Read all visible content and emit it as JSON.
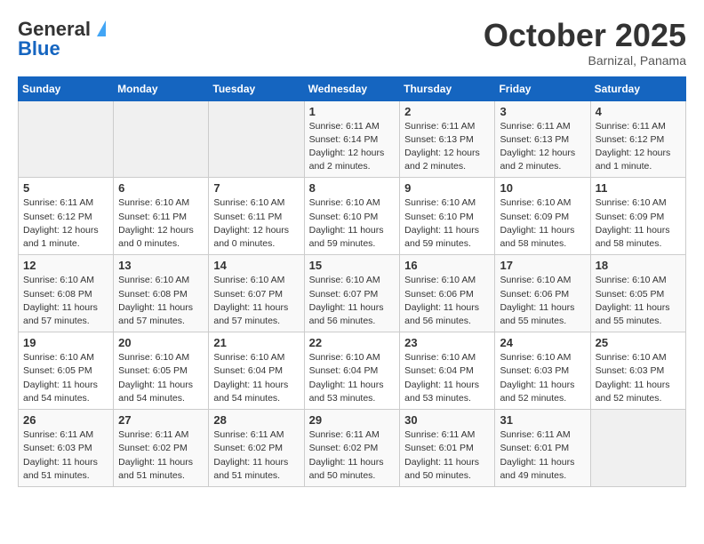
{
  "header": {
    "logo_general": "General",
    "logo_blue": "Blue",
    "month": "October 2025",
    "location": "Barnizal, Panama"
  },
  "days_of_week": [
    "Sunday",
    "Monday",
    "Tuesday",
    "Wednesday",
    "Thursday",
    "Friday",
    "Saturday"
  ],
  "weeks": [
    [
      {
        "day": "",
        "info": ""
      },
      {
        "day": "",
        "info": ""
      },
      {
        "day": "",
        "info": ""
      },
      {
        "day": "1",
        "info": "Sunrise: 6:11 AM\nSunset: 6:14 PM\nDaylight: 12 hours and 2 minutes."
      },
      {
        "day": "2",
        "info": "Sunrise: 6:11 AM\nSunset: 6:13 PM\nDaylight: 12 hours and 2 minutes."
      },
      {
        "day": "3",
        "info": "Sunrise: 6:11 AM\nSunset: 6:13 PM\nDaylight: 12 hours and 2 minutes."
      },
      {
        "day": "4",
        "info": "Sunrise: 6:11 AM\nSunset: 6:12 PM\nDaylight: 12 hours and 1 minute."
      }
    ],
    [
      {
        "day": "5",
        "info": "Sunrise: 6:11 AM\nSunset: 6:12 PM\nDaylight: 12 hours and 1 minute."
      },
      {
        "day": "6",
        "info": "Sunrise: 6:10 AM\nSunset: 6:11 PM\nDaylight: 12 hours and 0 minutes."
      },
      {
        "day": "7",
        "info": "Sunrise: 6:10 AM\nSunset: 6:11 PM\nDaylight: 12 hours and 0 minutes."
      },
      {
        "day": "8",
        "info": "Sunrise: 6:10 AM\nSunset: 6:10 PM\nDaylight: 11 hours and 59 minutes."
      },
      {
        "day": "9",
        "info": "Sunrise: 6:10 AM\nSunset: 6:10 PM\nDaylight: 11 hours and 59 minutes."
      },
      {
        "day": "10",
        "info": "Sunrise: 6:10 AM\nSunset: 6:09 PM\nDaylight: 11 hours and 58 minutes."
      },
      {
        "day": "11",
        "info": "Sunrise: 6:10 AM\nSunset: 6:09 PM\nDaylight: 11 hours and 58 minutes."
      }
    ],
    [
      {
        "day": "12",
        "info": "Sunrise: 6:10 AM\nSunset: 6:08 PM\nDaylight: 11 hours and 57 minutes."
      },
      {
        "day": "13",
        "info": "Sunrise: 6:10 AM\nSunset: 6:08 PM\nDaylight: 11 hours and 57 minutes."
      },
      {
        "day": "14",
        "info": "Sunrise: 6:10 AM\nSunset: 6:07 PM\nDaylight: 11 hours and 57 minutes."
      },
      {
        "day": "15",
        "info": "Sunrise: 6:10 AM\nSunset: 6:07 PM\nDaylight: 11 hours and 56 minutes."
      },
      {
        "day": "16",
        "info": "Sunrise: 6:10 AM\nSunset: 6:06 PM\nDaylight: 11 hours and 56 minutes."
      },
      {
        "day": "17",
        "info": "Sunrise: 6:10 AM\nSunset: 6:06 PM\nDaylight: 11 hours and 55 minutes."
      },
      {
        "day": "18",
        "info": "Sunrise: 6:10 AM\nSunset: 6:05 PM\nDaylight: 11 hours and 55 minutes."
      }
    ],
    [
      {
        "day": "19",
        "info": "Sunrise: 6:10 AM\nSunset: 6:05 PM\nDaylight: 11 hours and 54 minutes."
      },
      {
        "day": "20",
        "info": "Sunrise: 6:10 AM\nSunset: 6:05 PM\nDaylight: 11 hours and 54 minutes."
      },
      {
        "day": "21",
        "info": "Sunrise: 6:10 AM\nSunset: 6:04 PM\nDaylight: 11 hours and 54 minutes."
      },
      {
        "day": "22",
        "info": "Sunrise: 6:10 AM\nSunset: 6:04 PM\nDaylight: 11 hours and 53 minutes."
      },
      {
        "day": "23",
        "info": "Sunrise: 6:10 AM\nSunset: 6:04 PM\nDaylight: 11 hours and 53 minutes."
      },
      {
        "day": "24",
        "info": "Sunrise: 6:10 AM\nSunset: 6:03 PM\nDaylight: 11 hours and 52 minutes."
      },
      {
        "day": "25",
        "info": "Sunrise: 6:10 AM\nSunset: 6:03 PM\nDaylight: 11 hours and 52 minutes."
      }
    ],
    [
      {
        "day": "26",
        "info": "Sunrise: 6:11 AM\nSunset: 6:03 PM\nDaylight: 11 hours and 51 minutes."
      },
      {
        "day": "27",
        "info": "Sunrise: 6:11 AM\nSunset: 6:02 PM\nDaylight: 11 hours and 51 minutes."
      },
      {
        "day": "28",
        "info": "Sunrise: 6:11 AM\nSunset: 6:02 PM\nDaylight: 11 hours and 51 minutes."
      },
      {
        "day": "29",
        "info": "Sunrise: 6:11 AM\nSunset: 6:02 PM\nDaylight: 11 hours and 50 minutes."
      },
      {
        "day": "30",
        "info": "Sunrise: 6:11 AM\nSunset: 6:01 PM\nDaylight: 11 hours and 50 minutes."
      },
      {
        "day": "31",
        "info": "Sunrise: 6:11 AM\nSunset: 6:01 PM\nDaylight: 11 hours and 49 minutes."
      },
      {
        "day": "",
        "info": ""
      }
    ]
  ]
}
